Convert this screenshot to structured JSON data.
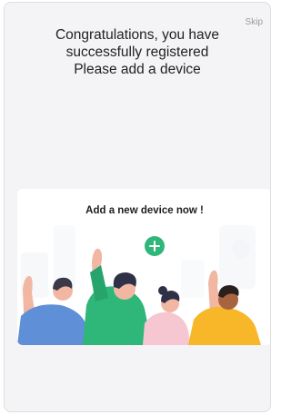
{
  "header": {
    "skip_label": "Skip",
    "title_lines": [
      "Congratulations, you have",
      "successfully registered",
      "Please add a device"
    ]
  },
  "promo_card": {
    "title": "Add a new device now !",
    "add_icon": "plus-circle-icon",
    "accent_color": "#2fb679"
  }
}
